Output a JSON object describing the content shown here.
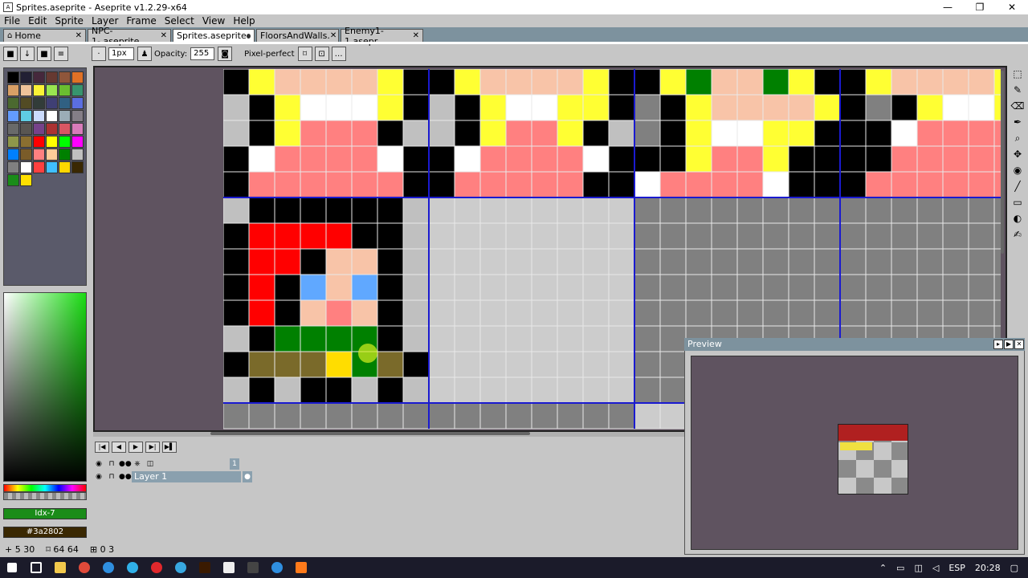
{
  "window": {
    "title": "Sprites.aseprite - Aseprite v1.2.29-x64",
    "app_icon": "aseprite-icon",
    "minimize": "—",
    "maximize": "❐",
    "close": "✕"
  },
  "menu": [
    "File",
    "Edit",
    "Sprite",
    "Layer",
    "Frame",
    "Select",
    "View",
    "Help"
  ],
  "tabs": [
    {
      "label": "Home",
      "icon": "home-icon",
      "active": false,
      "marker": "x"
    },
    {
      "label": "NPC-1-.aseprite",
      "active": false,
      "marker": "x"
    },
    {
      "label": "Sprites.aseprite",
      "active": true,
      "marker": "dot"
    },
    {
      "label": "FloorsAndWalls.",
      "active": false,
      "marker": "x"
    },
    {
      "label": "Enemy1-1.asepr",
      "active": false,
      "marker": "x"
    }
  ],
  "context_bar": {
    "brush_size": "1px",
    "opacity_label": "Opacity:",
    "opacity_value": "255",
    "pixel_perfect_label": "Pixel-perfect"
  },
  "palette": {
    "colors": [
      "#000000",
      "#222034",
      "#45283c",
      "#663931",
      "#8f563b",
      "#df7126",
      "#d9a066",
      "#eec39a",
      "#fbf236",
      "#99e550",
      "#6abe30",
      "#37946e",
      "#4b692f",
      "#524b24",
      "#323c39",
      "#3f3f74",
      "#306082",
      "#5b6ee1",
      "#639bff",
      "#5fcde4",
      "#cbdbfc",
      "#ffffff",
      "#9badb7",
      "#847e87",
      "#696a6a",
      "#595652",
      "#76428a",
      "#ac3232",
      "#d95763",
      "#d77bba",
      "#8f974a",
      "#8a6f30",
      "#ff0000",
      "#ffff00",
      "#00ff00",
      "#ff00ff",
      "#0080ff",
      "#7a5c29",
      "#ff8080",
      "#ffcc99",
      "#008000",
      "#c0c0c0",
      "#808080",
      "#ffffff",
      "#ff4040",
      "#40c0ff",
      "#ffd700",
      "#3a2802",
      "#1a8c19",
      "#ffe000"
    ]
  },
  "color_bar": {
    "fg_label": "Idx-7",
    "bg_label": "#3a2802",
    "fg_color": "#1a8c19",
    "bg_color": "#3a2802"
  },
  "timeline": {
    "header_frame": "1",
    "layer_name": "Layer 1"
  },
  "preview": {
    "title": "Preview"
  },
  "status": {
    "cursor": "+ 5 30",
    "size": "⌑ 64 64",
    "frame": "⊞ 0 3"
  },
  "tray": {
    "lang": "ESP",
    "time": "20:28"
  },
  "sprite_pixels": {
    "legend": {
      "K": "#000000",
      "Y": "#ffff33",
      "S": "#f8c4a8",
      "W": "#ffffff",
      "P": "#ff8080",
      "G": "#c0c0c0",
      "D": "#808080",
      "R": "#ff0000",
      "B": "#60a8ff",
      "N": "#008000",
      "O": "#7a6a2a",
      "F": "#ffdd00",
      "L": "#cccccc"
    },
    "rows": [
      "KYSSSSYKKYSSSSYKKYNSSNYKKYSSSSYK",
      "GKYWWWYKGKYWWYYKDKYSSSSYKDKYWWYK",
      "GKYPPPKGGKYPPYKGDKYWWYYKKKWPPPPK",
      "KWPPPPWKKWPPPPWKKKYPPYKKKKPPPPPK",
      "KPPPPPPKKPPPPPKKWPPPPWKKKPPPPPPK",
      "GKKKKKKGLLLLLLLLDDDDDDDDDDDDDDDD",
      "KRRRRKKGLLLLLLLLDDDDDDDDDDDDDDDD",
      "KRRKSSKGLLLLLLLLDDDDDDDDDDDDDDDD",
      "KRKBSBKGLLLLLLLLDDDDDDDDDDDDDDDD",
      "KRKSPSKGLLLLLLLLDDDDDDDDDDDDDDDD",
      "GKNNNNKGLLLLLLLLDDDDDDDDDDDDDDDD",
      "KOOOFNOKLLLLLLLLDDDDDDDDDDDDDDDD",
      "GKGKKGKGLLLLLLLLDDDDDDDDDDDDDDDD",
      "DDDDDDDDDDDDDDDDLLLLLLLLLLLLLLLL"
    ]
  }
}
